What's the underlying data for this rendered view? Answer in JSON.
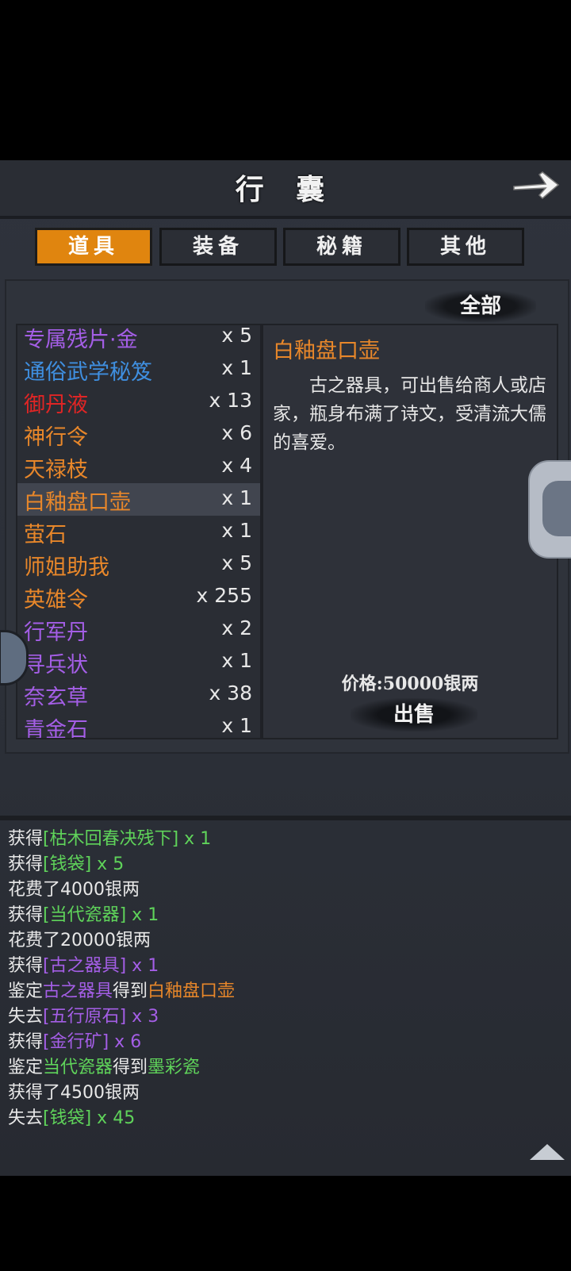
{
  "header": {
    "title": "行 囊",
    "back_icon": "arrow-right-icon"
  },
  "tabs": [
    {
      "label": "道具",
      "active": true
    },
    {
      "label": "装备",
      "active": false
    },
    {
      "label": "秘籍",
      "active": false
    },
    {
      "label": "其他",
      "active": false
    }
  ],
  "filter": {
    "label": "全部"
  },
  "items": [
    {
      "name": "专属残片·金",
      "qty": "x 5",
      "color": "#a45ee6"
    },
    {
      "name": "通俗武学秘笈",
      "qty": "x 1",
      "color": "#3f8fe0"
    },
    {
      "name": "御丹液",
      "qty": "x 13",
      "color": "#e02525"
    },
    {
      "name": "神行令",
      "qty": "x 6",
      "color": "#e8872a"
    },
    {
      "name": "天禄枝",
      "qty": "x 4",
      "color": "#e8872a"
    },
    {
      "name": "白釉盘口壶",
      "qty": "x 1",
      "color": "#e8872a",
      "selected": true
    },
    {
      "name": "萤石",
      "qty": "x 1",
      "color": "#e8872a"
    },
    {
      "name": "师姐助我",
      "qty": "x 5",
      "color": "#e8872a"
    },
    {
      "name": "英雄令",
      "qty": "x 255",
      "color": "#e8872a"
    },
    {
      "name": "行军丹",
      "qty": "x 2",
      "color": "#a45ee6"
    },
    {
      "name": "寻兵状",
      "qty": "x 1",
      "color": "#a45ee6"
    },
    {
      "name": "奈玄草",
      "qty": "x 38",
      "color": "#a45ee6"
    },
    {
      "name": "青金石",
      "qty": "x 1",
      "color": "#a45ee6"
    }
  ],
  "detail": {
    "name": "白釉盘口壶",
    "description": "古之器具，可出售给商人或店家，瓶身布满了诗文，受清流大儒的喜爱。",
    "price": "价格:50000银两",
    "sell_label": "出售"
  },
  "log": [
    [
      {
        "t": "获得"
      },
      {
        "t": "[枯木回春决残下]",
        "c": "green"
      },
      {
        "t": " x 1",
        "c": "green"
      }
    ],
    [
      {
        "t": "获得"
      },
      {
        "t": "[钱袋]",
        "c": "green"
      },
      {
        "t": " x 5",
        "c": "green"
      }
    ],
    [
      {
        "t": "花费了4000银两"
      }
    ],
    [
      {
        "t": "获得"
      },
      {
        "t": "[当代瓷器]",
        "c": "green"
      },
      {
        "t": " x 1",
        "c": "green"
      }
    ],
    [
      {
        "t": "花费了20000银两"
      }
    ],
    [
      {
        "t": "获得"
      },
      {
        "t": "[古之器具]",
        "c": "purple"
      },
      {
        "t": " x 1",
        "c": "purple"
      }
    ],
    [
      {
        "t": "鉴定"
      },
      {
        "t": "古之器具",
        "c": "purple"
      },
      {
        "t": "得到"
      },
      {
        "t": "白釉盘口壶",
        "c": "orange"
      }
    ],
    [
      {
        "t": "失去"
      },
      {
        "t": "[五行原石]",
        "c": "purple"
      },
      {
        "t": " x 3",
        "c": "purple"
      }
    ],
    [
      {
        "t": "获得"
      },
      {
        "t": "[金行矿]",
        "c": "purple"
      },
      {
        "t": " x 6",
        "c": "purple"
      }
    ],
    [
      {
        "t": "鉴定"
      },
      {
        "t": "当代瓷器",
        "c": "green"
      },
      {
        "t": "得到"
      },
      {
        "t": "墨彩瓷",
        "c": "green"
      }
    ],
    [
      {
        "t": "获得了4500银两"
      }
    ],
    [
      {
        "t": "失去"
      },
      {
        "t": "[钱袋]",
        "c": "green"
      },
      {
        "t": " x 45",
        "c": "green"
      }
    ]
  ]
}
